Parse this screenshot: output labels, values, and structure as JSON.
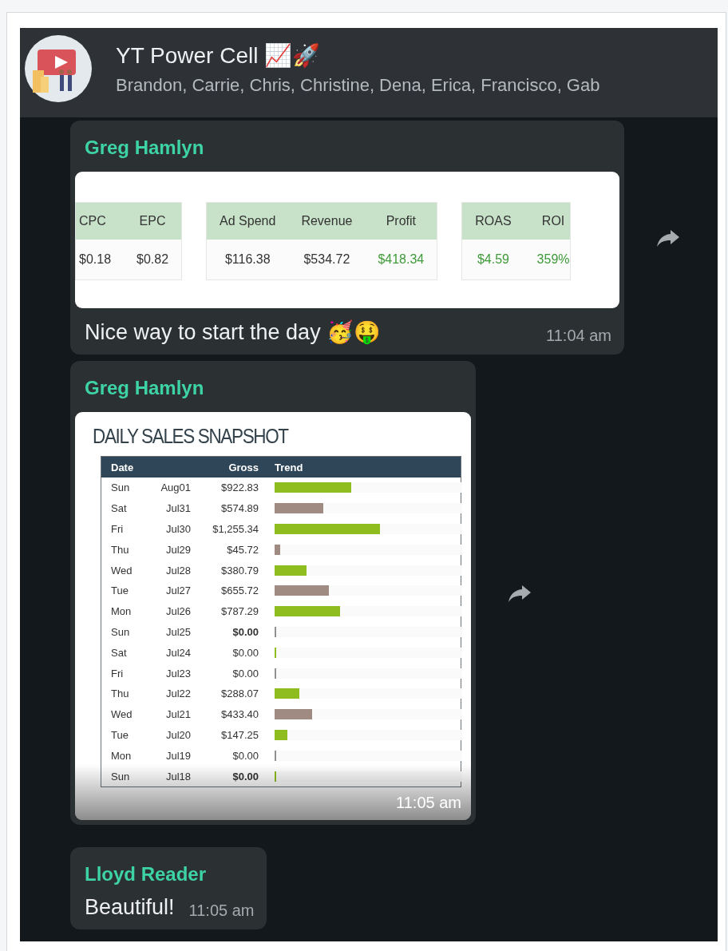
{
  "header": {
    "title": "YT Power Cell 📈🚀",
    "members": "Brandon, Carrie, Chris, Christine, Dena, Erica, Francisco, Gab"
  },
  "messages": [
    {
      "kind": "stats",
      "sender": "Greg Hamlyn",
      "text": "Nice way to start the day 🥳🤑",
      "time": "11:04 am",
      "groups": [
        {
          "columns": [
            {
              "label": "CPC",
              "value": "$0.18",
              "positive": false
            },
            {
              "label": "EPC",
              "value": "$0.82",
              "positive": false
            }
          ]
        },
        {
          "columns": [
            {
              "label": "Ad Spend",
              "value": "$116.38",
              "positive": false
            },
            {
              "label": "Revenue",
              "value": "$534.72",
              "positive": false
            },
            {
              "label": "Profit",
              "value": "$418.34",
              "positive": true
            }
          ]
        },
        {
          "columns": [
            {
              "label": "ROAS",
              "value": "$4.59",
              "positive": true
            },
            {
              "label": "ROI",
              "value": "359%",
              "positive": true
            }
          ]
        }
      ]
    },
    {
      "kind": "snapshot",
      "sender": "Greg Hamlyn",
      "time": "11:05 am",
      "title": "DAILY SALES SNAPSHOT",
      "columns": [
        "Date",
        "Gross",
        "Trend"
      ],
      "rows": [
        {
          "day": "Sun",
          "date": "Aug01",
          "gross": "$922.83",
          "bold": false,
          "level": 0.41,
          "color": "#8fbc1e"
        },
        {
          "day": "Sat",
          "date": "Jul31",
          "gross": "$574.89",
          "bold": false,
          "level": 0.26,
          "color": "#a08b82"
        },
        {
          "day": "Fri",
          "date": "Jul30",
          "gross": "$1,255.34",
          "bold": false,
          "level": 0.56,
          "color": "#8fbc1e"
        },
        {
          "day": "Thu",
          "date": "Jul29",
          "gross": "$45.72",
          "bold": false,
          "level": 0.03,
          "color": "#a08b82"
        },
        {
          "day": "Wed",
          "date": "Jul28",
          "gross": "$380.79",
          "bold": false,
          "level": 0.17,
          "color": "#8fbc1e"
        },
        {
          "day": "Tue",
          "date": "Jul27",
          "gross": "$655.72",
          "bold": false,
          "level": 0.29,
          "color": "#a08b82"
        },
        {
          "day": "Mon",
          "date": "Jul26",
          "gross": "$787.29",
          "bold": false,
          "level": 0.35,
          "color": "#8fbc1e"
        },
        {
          "day": "Sun",
          "date": "Jul25",
          "gross": "$0.00",
          "bold": true,
          "level": 0.005,
          "color": "#909090"
        },
        {
          "day": "Sat",
          "date": "Jul24",
          "gross": "$0.00",
          "bold": false,
          "level": 0.005,
          "color": "#8fbc1e"
        },
        {
          "day": "Fri",
          "date": "Jul23",
          "gross": "$0.00",
          "bold": false,
          "level": 0.005,
          "color": "#909090"
        },
        {
          "day": "Thu",
          "date": "Jul22",
          "gross": "$288.07",
          "bold": false,
          "level": 0.13,
          "color": "#8fbc1e"
        },
        {
          "day": "Wed",
          "date": "Jul21",
          "gross": "$433.40",
          "bold": false,
          "level": 0.2,
          "color": "#a08b82"
        },
        {
          "day": "Tue",
          "date": "Jul20",
          "gross": "$147.25",
          "bold": false,
          "level": 0.07,
          "color": "#8fbc1e"
        },
        {
          "day": "Mon",
          "date": "Jul19",
          "gross": "$0.00",
          "bold": false,
          "level": 0.005,
          "color": "#909090"
        },
        {
          "day": "Sun",
          "date": "Jul18",
          "gross": "$0.00",
          "bold": true,
          "level": 0.005,
          "color": "#8fbc1e"
        }
      ]
    },
    {
      "kind": "text",
      "sender": "Lloyd Reader",
      "text": "Beautiful!",
      "time": "11:05 am"
    }
  ]
}
